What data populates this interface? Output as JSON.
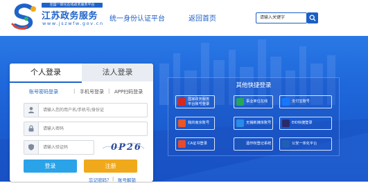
{
  "header": {
    "brand_tag": "全国一体化在线政务服务平台",
    "brand_title": "江苏政务服务",
    "brand_url": "www.jszwfw.gov.cn",
    "nav_title": "统一身份认证平台",
    "nav_home": "返回首页",
    "search_placeholder": "请输入关键字"
  },
  "login": {
    "tabs": [
      {
        "label": "个人登录",
        "active": true
      },
      {
        "label": "法人登录",
        "active": false
      }
    ],
    "methods": [
      {
        "label": "账号密码登录",
        "active": true
      },
      {
        "label": "手机号登录",
        "active": false
      },
      {
        "label": "APP扫码登录",
        "active": false
      }
    ],
    "separator": "|",
    "username_placeholder": "请输入您的用户名/手机号/身份证",
    "password_placeholder": "请输入密码",
    "captcha_placeholder": "请输入验证码",
    "captcha_text": "0P26",
    "login_button": "登录",
    "register_button": "注册",
    "forgot_password": "忘记密码？",
    "account_unlock": "账号解锁"
  },
  "quick": {
    "title": "其他快捷登录",
    "items": [
      {
        "label_line1": "国家政务服务",
        "label_line2": "平台账号登录",
        "icon": "national-emblem-icon",
        "color": "#d9271d"
      },
      {
        "label_line1": "事业单位在线",
        "label_line2": "",
        "icon": "institution-online-icon",
        "color": "#26a65b"
      },
      {
        "label_line1": "支付宝账号",
        "label_line2": "",
        "icon": "alipay-icon",
        "color": "#1677ff"
      },
      {
        "label_line1": "我的南京账号",
        "label_line2": "",
        "icon": "my-nanjing-icon",
        "color": "#e9562a"
      },
      {
        "label_line1": "无锡新媒体账号",
        "label_line2": "",
        "icon": "wuxi-icon",
        "color": "#2b8be8"
      },
      {
        "label_line1": "EID快捷登录",
        "label_line2": "",
        "icon": "eid-icon",
        "color": "#2b2b6b"
      },
      {
        "label_line1": "CA证书登录",
        "label_line2": "",
        "icon": "ca-certificate-icon",
        "color": "#e84a2b"
      },
      {
        "label_line1": "酒作权登记系统",
        "label_line2": "",
        "icon": "registration-system-icon",
        "color": "#1b55b8"
      },
      {
        "label_line1": "公安一体化平台",
        "label_line2": "",
        "icon": "police-platform-icon",
        "color": "#1f5fb5"
      }
    ]
  }
}
